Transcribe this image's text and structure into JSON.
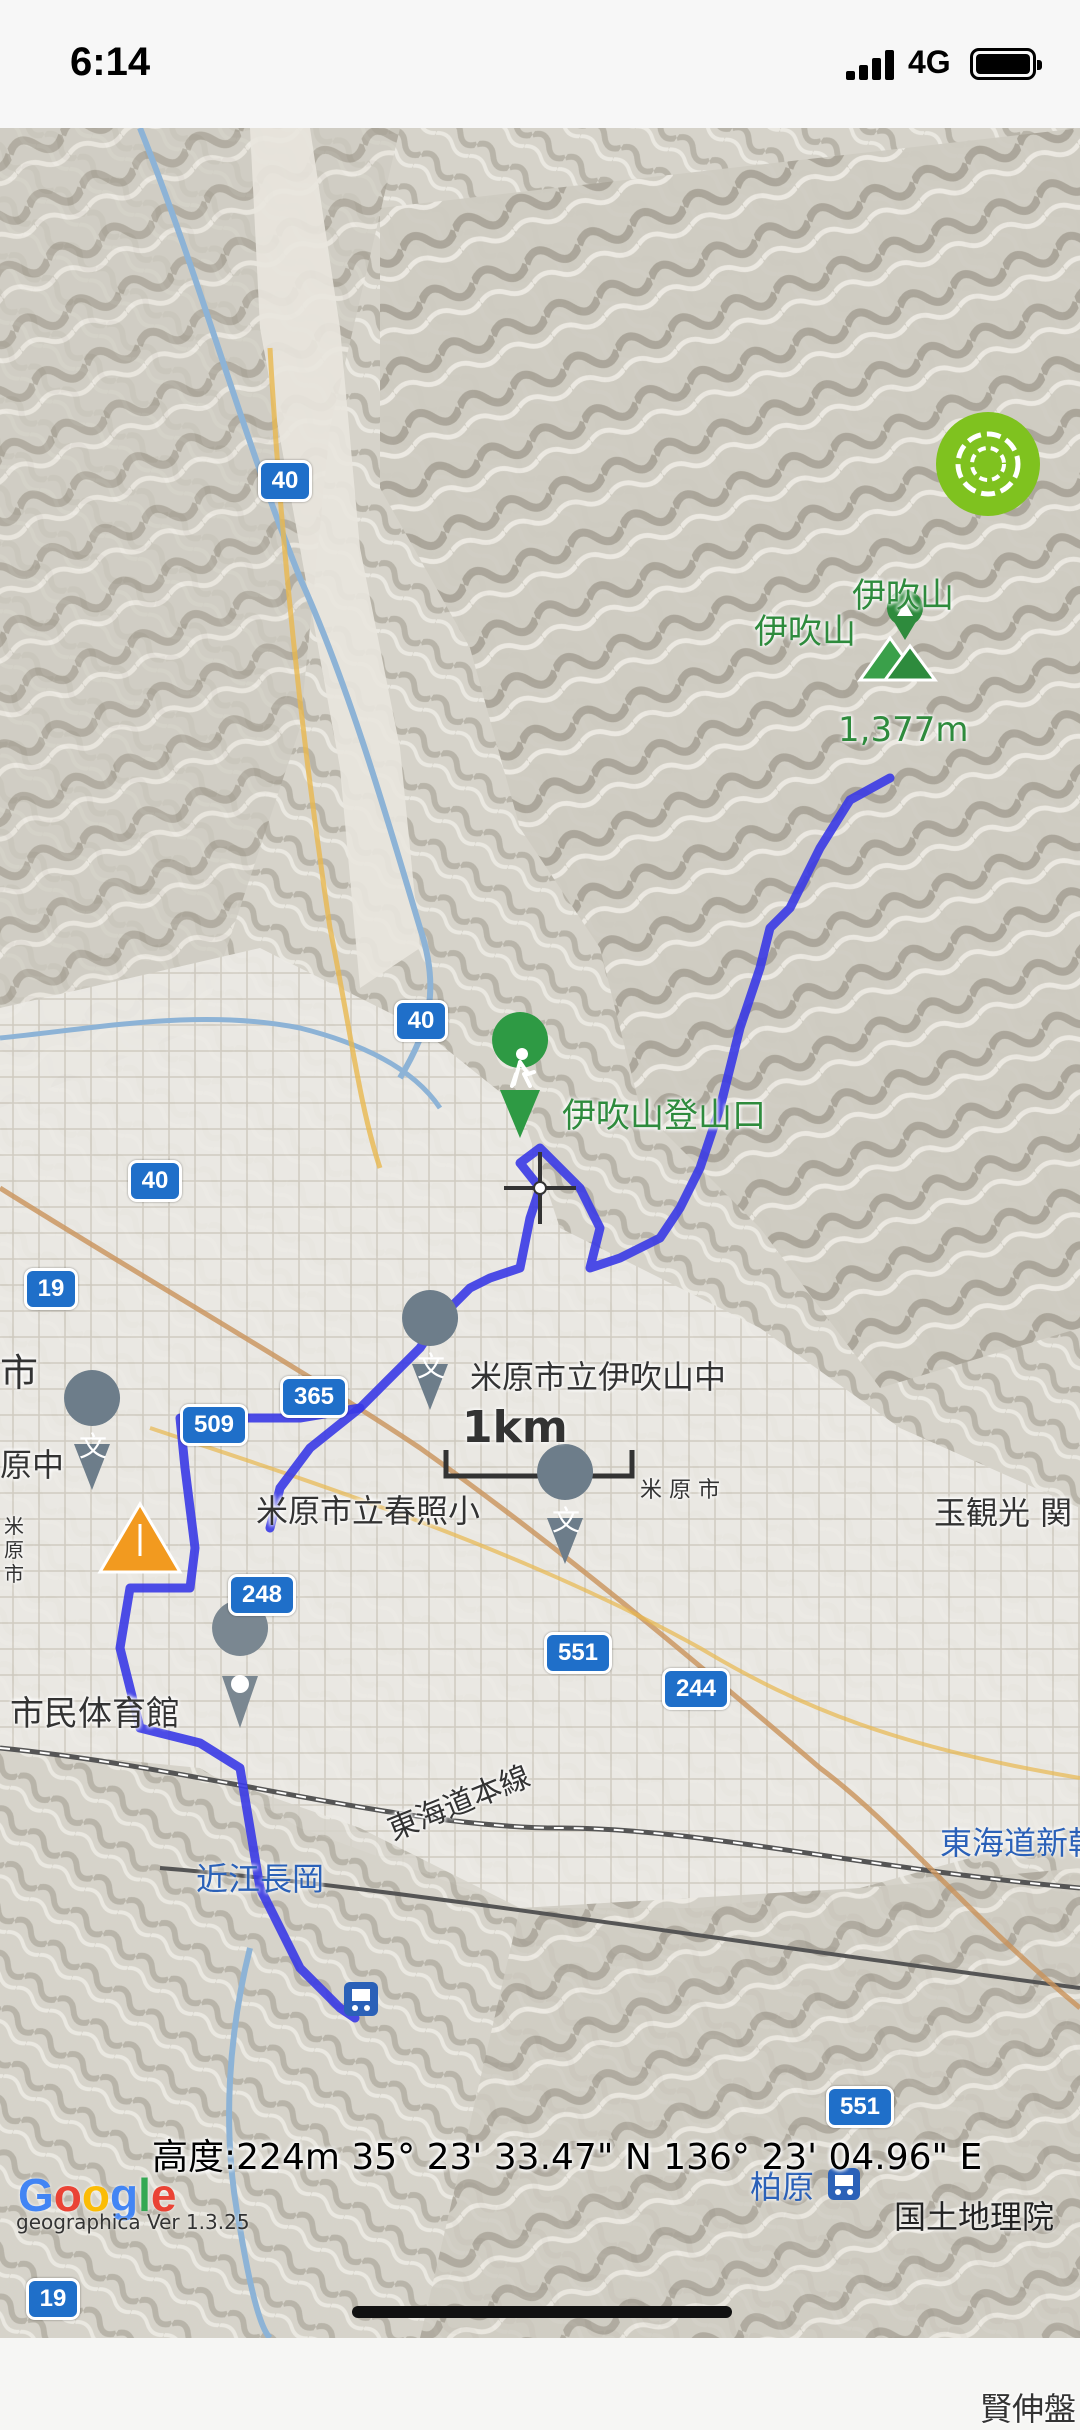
{
  "status_bar": {
    "time": "6:14",
    "network": "4G"
  },
  "map": {
    "peak": {
      "name_label": "伊吹山",
      "name_label_2": "伊吹山",
      "elevation": "1,377m",
      "icon": "mountain-peak-icon",
      "color": "#2e8b3d"
    },
    "trailhead": {
      "label": "伊吹山登山口",
      "icon": "hiker-pin-icon",
      "color": "#2e8b3d"
    },
    "schools": [
      {
        "label": "米原市立伊吹山中"
      },
      {
        "label": "米原市立春照小"
      }
    ],
    "place_labels": {
      "city_hall_area": "市民体育館",
      "station": "近江長岡",
      "railway": "東海道本線",
      "shinkansen": "東海道新幹",
      "kashiwabara": "柏原",
      "gyokukan": "玉観光 関",
      "kenshin": "賢伸盤",
      "maibara_city": "米 原 市",
      "left_shi": "市",
      "left_haraNaka": "原中",
      "left_vertical": "米原市"
    },
    "road_shields": [
      "40",
      "40",
      "40",
      "19",
      "509",
      "365",
      "248",
      "551",
      "244",
      "551",
      "19"
    ],
    "scale": {
      "label": "1km"
    },
    "route_color": "#3a3ae6",
    "footer": {
      "coords": "高度:224m  35° 23' 33.47\" N 136° 23' 04.96\" E",
      "google": "Google",
      "version": "geographica Ver 1.3.25",
      "attribution": "国土地理院"
    },
    "accent_button_color": "#7fc21f",
    "warning_marker_color": "#f29a1f"
  }
}
